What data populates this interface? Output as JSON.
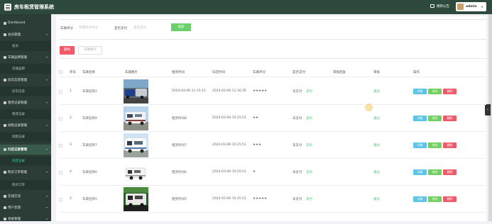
{
  "app": {
    "title": "房车租赁管理系统"
  },
  "header": {
    "notice_label": "跳转公告",
    "user_name": "admin",
    "user_caret": "▾"
  },
  "sidebar": {
    "items": [
      {
        "label": "Dashboard",
        "type": "group"
      },
      {
        "label": "会员管理",
        "type": "group",
        "caret": "▾"
      },
      {
        "label": "会员",
        "type": "sub"
      },
      {
        "label": "车辆品牌管理",
        "type": "group",
        "caret": "▾"
      },
      {
        "label": "车辆品牌",
        "type": "sub"
      },
      {
        "label": "房车信息管理",
        "type": "group",
        "caret": "▾"
      },
      {
        "label": "房车信息",
        "type": "sub"
      },
      {
        "label": "租赁记录管理",
        "type": "group",
        "caret": "▾"
      },
      {
        "label": "租赁记录",
        "type": "sub"
      },
      {
        "label": "续租记录管理",
        "type": "group",
        "caret": "▾"
      },
      {
        "label": "续租记录",
        "type": "sub"
      },
      {
        "label": "归还记录管理",
        "type": "group",
        "caret": "▾",
        "active": true
      },
      {
        "label": "归还记录",
        "type": "sub",
        "current": true
      },
      {
        "label": "购买订单管理",
        "type": "group",
        "caret": "▾"
      },
      {
        "label": "购买订单",
        "type": "sub"
      },
      {
        "label": "在线交流",
        "type": "group",
        "caret": "▾"
      },
      {
        "label": "用户反馈",
        "type": "group",
        "caret": "▾"
      },
      {
        "label": "系统管理",
        "type": "group",
        "caret": "▾"
      }
    ]
  },
  "search": {
    "rating_label": "车辆评分",
    "rating_placeholder": "车辆评分评分",
    "paid_label": "是否支付",
    "paid_placeholder": "是否支付",
    "search_button": "搜索"
  },
  "toolbar": {
    "delete_button": "删除",
    "stats_button": "车辆统计"
  },
  "table": {
    "headers": [
      "序号",
      "车辆名称",
      "车辆图片",
      "租赁时间",
      "归还时间",
      "车辆评分",
      "是否支付",
      "审核回复",
      "审核",
      "操作"
    ],
    "rows": [
      {
        "index": "1",
        "name": "车辆名称2",
        "rent_time": "2024-03-08 11:15:15",
        "return_time": "2024-03-08 11:16:26",
        "rating": "★★★★★",
        "paid": "未支付",
        "pay_link": "支付",
        "reply": "",
        "audit": "通过"
      },
      {
        "index": "2",
        "name": "车辆名称8",
        "rent_time": "租赁时间8",
        "return_time": "2024-03-08 10:25:51",
        "rating": "★★",
        "paid": "未支付",
        "pay_link": "支付",
        "reply": "",
        "audit": "通过"
      },
      {
        "index": "3",
        "name": "车辆名称7",
        "rent_time": "租赁时间7",
        "return_time": "2024-03-08 10:25:51",
        "rating": "★★★",
        "paid": "未支付",
        "pay_link": "支付",
        "reply": "",
        "audit": "通过"
      },
      {
        "index": "4",
        "name": "车辆名称6",
        "rent_time": "租赁时间6",
        "return_time": "2024-03-08 10:25:51",
        "rating": "★",
        "paid": "未支付",
        "pay_link": "支付",
        "reply": "",
        "audit": "通过"
      },
      {
        "index": "5",
        "name": "车辆名称5",
        "rent_time": "租赁时间5",
        "return_time": "2024-03-08 10:25:51",
        "rating": "★★★★★",
        "paid": "未支付",
        "pay_link": "支付",
        "reply": "",
        "audit": "通过"
      }
    ],
    "actions": {
      "detail": "详情",
      "edit": "修改",
      "delete": "删除"
    }
  },
  "colors": {
    "topbar": "#2e4a3d",
    "sidebar": "#2b3d36",
    "accent_green": "#41d3a0",
    "search_button": "#6bd06b",
    "delete_button": "#f15a6b"
  }
}
